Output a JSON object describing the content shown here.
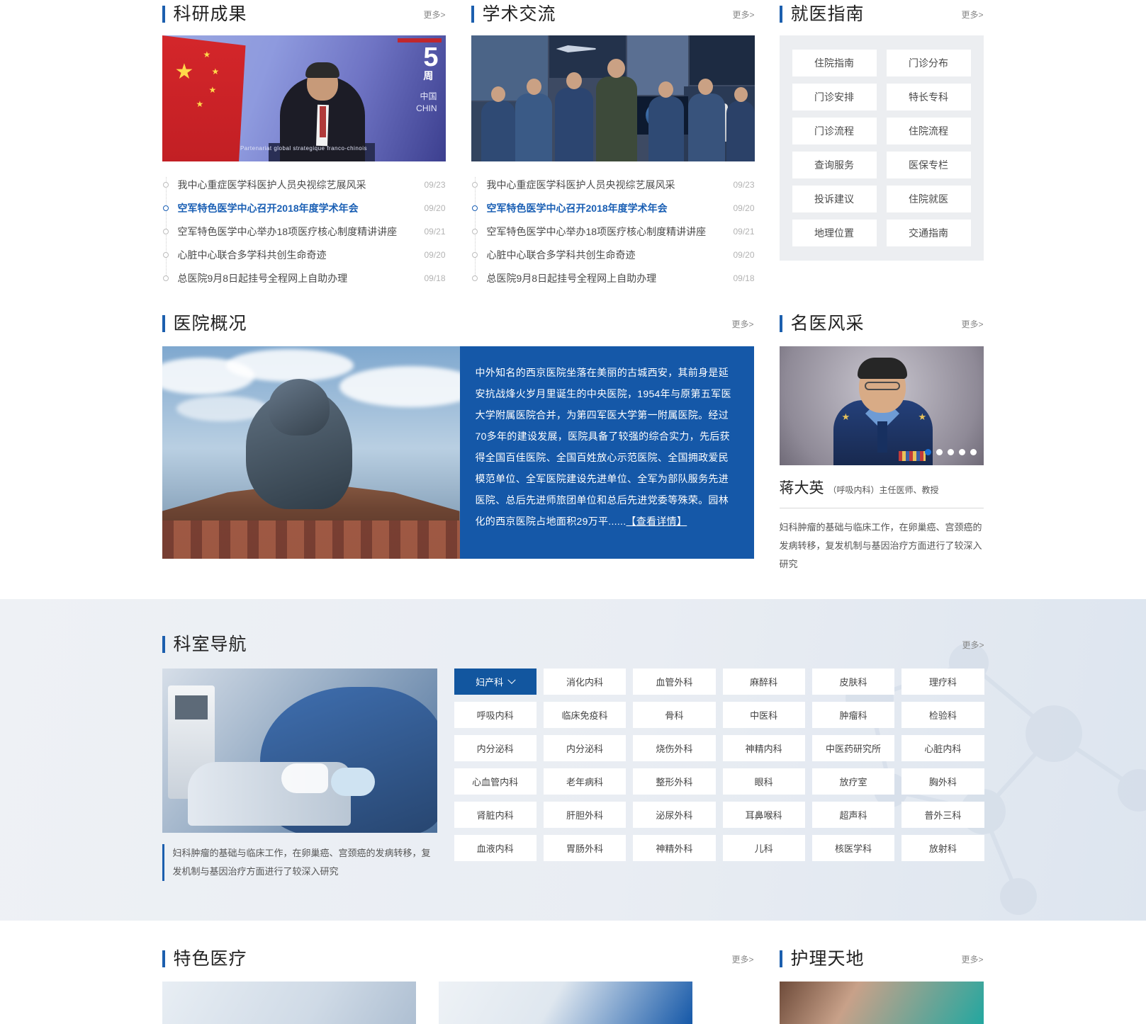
{
  "sections": {
    "research": {
      "title": "科研成果",
      "more": "更多>",
      "items": [
        {
          "title": "我中心重症医学科医护人员央视综艺展风采",
          "date": "09/23",
          "active": false
        },
        {
          "title": "空军特色医学中心召开2018年度学术年会",
          "date": "09/20",
          "active": true
        },
        {
          "title": "空军特色医学中心举办18项医疗核心制度精讲讲座",
          "date": "09/21",
          "active": false
        },
        {
          "title": "心脏中心联合多学科共创生命奇迹",
          "date": "09/20",
          "active": false
        },
        {
          "title": "总医院9月8日起挂号全程网上自助办理",
          "date": "09/18",
          "active": false
        }
      ]
    },
    "academic": {
      "title": "学术交流",
      "more": "更多>",
      "items": [
        {
          "title": "我中心重症医学科医护人员央视综艺展风采",
          "date": "09/23",
          "active": false
        },
        {
          "title": "空军特色医学中心召开2018年度学术年会",
          "date": "09/20",
          "active": true
        },
        {
          "title": "空军特色医学中心举办18项医疗核心制度精讲讲座",
          "date": "09/21",
          "active": false
        },
        {
          "title": "心脏中心联合多学科共创生命奇迹",
          "date": "09/20",
          "active": false
        },
        {
          "title": "总医院9月8日起挂号全程网上自助办理",
          "date": "09/18",
          "active": false
        }
      ]
    },
    "guide": {
      "title": "就医指南",
      "more": "更多>",
      "buttons": [
        "住院指南",
        "门诊分布",
        "门诊安排",
        "特长专科",
        "门诊流程",
        "住院流程",
        "查询服务",
        "医保专栏",
        "投诉建议",
        "住院就医",
        "地理位置",
        "交通指南"
      ]
    },
    "overview": {
      "title": "医院概况",
      "more": "更多>",
      "body": "中外知名的西京医院坐落在美丽的古城西安，其前身是延安抗战烽火岁月里诞生的中央医院，1954年与原第五军医大学附属医院合并，为第四军医大学第一附属医院。经过70多年的建设发展，医院具备了较强的综合实力，先后获得全国百佳医院、全国百姓放心示范医院、全国拥政爱民模范单位、全军医院建设先进单位、全军为部队服务先进医院、总后先进师旅团单位和总后先进党委等殊荣。园林化的西京医院占地面积29万平......",
      "detail_link": "【查看详情】",
      "photo_caption": ""
    },
    "doctor": {
      "title": "名医风采",
      "more": "更多>",
      "name": "蒋大英",
      "meta": "（呼吸内科）主任医师、教授",
      "desc": "妇科肿瘤的基础与临床工作，在卵巢癌、宫颈癌的发病转移，复发机制与基因治疗方面进行了较深入研究",
      "dots": 5,
      "active_dot": 0
    },
    "departments": {
      "title": "科室导航",
      "more": "更多>",
      "caption": "妇科肿瘤的基础与临床工作，在卵巢癌、宫颈癌的发病转移，复发机制与基因治疗方面进行了较深入研究",
      "active_index": 0,
      "items": [
        "妇产科",
        "消化内科",
        "血管外科",
        "麻醉科",
        "皮肤科",
        "理疗科",
        "呼吸内科",
        "临床免疫科",
        "骨科",
        "中医科",
        "肿瘤科",
        "检验科",
        "内分泌科",
        "内分泌科",
        "烧伤外科",
        "神精内科",
        "中医药研究所",
        "心脏内科",
        "心血管内科",
        "老年病科",
        "整形外科",
        "眼科",
        "放疗室",
        "胸外科",
        "肾脏内科",
        "肝胆外科",
        "泌尿外科",
        "耳鼻喉科",
        "超声科",
        "普外三科",
        "血液内科",
        "胃肠外科",
        "神精外科",
        "儿科",
        "核医学科",
        "放射科"
      ]
    },
    "feature": {
      "title": "特色医疗",
      "more": "更多>"
    },
    "nursing": {
      "title": "护理天地",
      "more": "更多>"
    }
  },
  "colors": {
    "accent": "#1c5fae",
    "active_blue": "#12569f",
    "overview_bg": "#1558a8",
    "link_blue": "#1a5fb4"
  }
}
